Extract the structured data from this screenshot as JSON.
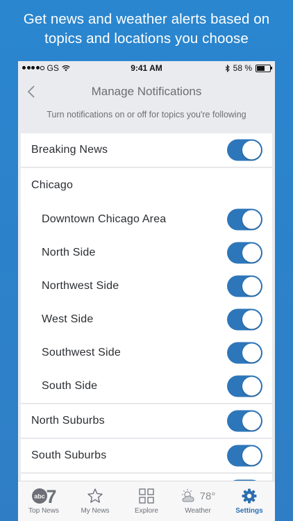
{
  "promo": {
    "line1": "Get news and weather alerts based on",
    "line2": "topics and locations you choose"
  },
  "status_bar": {
    "carrier": "GS",
    "time": "9:41 AM",
    "battery": "58 %"
  },
  "nav": {
    "title": "Manage Notifications"
  },
  "subtitle": "Turn notifications on or off for topics you're following",
  "rows": [
    {
      "label": "Breaking News",
      "toggle": true
    },
    {
      "label": "Chicago"
    },
    {
      "label": "Downtown Chicago Area",
      "toggle": true
    },
    {
      "label": "North Side",
      "toggle": true
    },
    {
      "label": "Northwest Side",
      "toggle": true
    },
    {
      "label": "West Side",
      "toggle": true
    },
    {
      "label": "Southwest Side",
      "toggle": true
    },
    {
      "label": "South Side",
      "toggle": true
    },
    {
      "label": "North Suburbs",
      "toggle": true
    },
    {
      "label": "South Suburbs",
      "toggle": true
    }
  ],
  "tabbar": {
    "tabs": [
      {
        "label": "Top News",
        "icon": "abc7-logo-icon"
      },
      {
        "label": "My News",
        "icon": "star-icon"
      },
      {
        "label": "Explore",
        "icon": "grid-icon"
      },
      {
        "label": "Weather",
        "icon": "sun-cloud-icon",
        "temp": "78°"
      },
      {
        "label": "Settings",
        "icon": "gear-icon",
        "active": true
      }
    ]
  },
  "colors": {
    "background": "#2a86cf",
    "toggle_on": "#2d76ba",
    "active_tab": "#2d6fb2"
  }
}
